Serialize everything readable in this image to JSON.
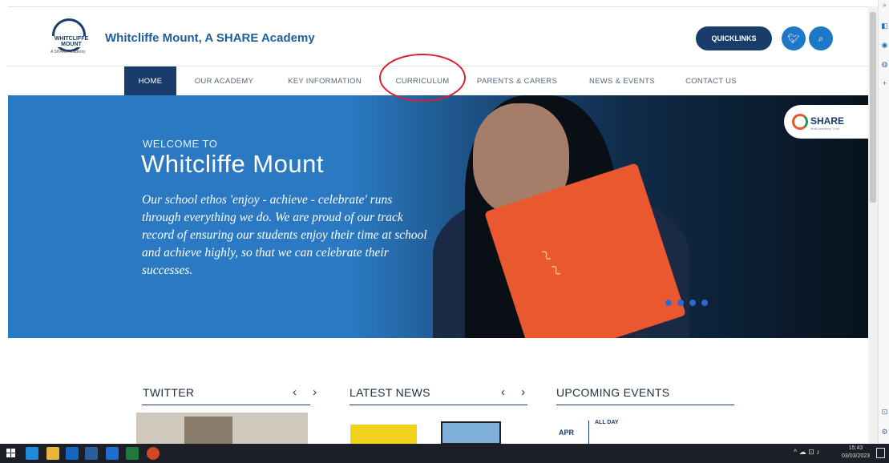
{
  "header": {
    "logo_text": "WHITCLIFFE MOUNT",
    "logo_sub": "A SHARE Academy",
    "site_title": "Whitcliffe Mount, A SHARE Academy",
    "quicklinks_label": "QUICKLINKS",
    "twitter_icon": "twitter-icon",
    "search_icon": "search-icon"
  },
  "nav": {
    "items": [
      {
        "label": "HOME",
        "active": true
      },
      {
        "label": "OUR ACADEMY",
        "active": false
      },
      {
        "label": "KEY INFORMATION",
        "active": false
      },
      {
        "label": "CURRICULUM",
        "active": false
      },
      {
        "label": "PARENTS & CARERS",
        "active": false
      },
      {
        "label": "NEWS & EVENTS",
        "active": false
      },
      {
        "label": "CONTACT US",
        "active": false
      }
    ]
  },
  "hero": {
    "welcome": "WELCOME TO",
    "title": "Whitcliffe Mount",
    "text": "Our school ethos 'enjoy - achieve - celebrate' runs through everything we do. We are proud of our track record of ensuring our students enjoy their time at school and achieve highly, so that we can celebrate their successes.",
    "share_label": "SHARE",
    "share_sub": "Multi Academy Trust",
    "slides_count": 4
  },
  "sections": {
    "twitter": {
      "title": "TWITTER",
      "arrows": "‹ ›"
    },
    "news": {
      "title": "LATEST NEWS",
      "arrows": "‹ ›"
    },
    "events": {
      "title": "UPCOMING EVENTS",
      "month": "APR",
      "time": "ALL DAY"
    }
  },
  "taskbar": {
    "time": "15:43",
    "date": "03/03/2023"
  },
  "colors": {
    "brand_navy": "#1a3c6b",
    "brand_blue": "#1e78c8",
    "hero_blue": "#2a79c2",
    "annotation_red": "#d9202e"
  }
}
